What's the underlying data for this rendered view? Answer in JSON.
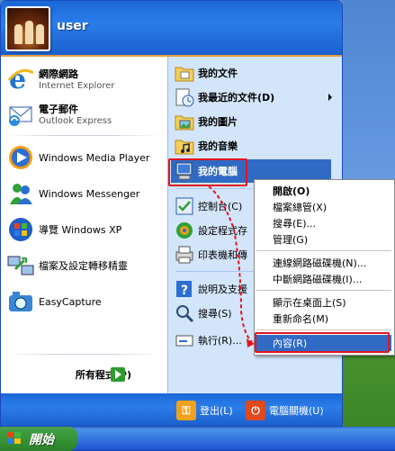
{
  "user": {
    "name": "user"
  },
  "left_items": [
    {
      "title": "網際網路",
      "subtitle": "Internet Explorer",
      "icon": "internet-explorer-icon"
    },
    {
      "title": "電子郵件",
      "subtitle": "Outlook Express",
      "icon": "outlook-express-icon"
    },
    {
      "label": "Windows Media Player",
      "icon": "media-player-icon"
    },
    {
      "label": "Windows Messenger",
      "icon": "messenger-icon"
    },
    {
      "label": "導覽 Windows XP",
      "icon": "tour-xp-icon"
    },
    {
      "label": "檔案及設定轉移精靈",
      "icon": "transfer-wizard-icon"
    },
    {
      "label": "EasyCapture",
      "icon": "easycapture-icon"
    }
  ],
  "all_programs": {
    "label": "所有程式(P)"
  },
  "right_items": [
    {
      "label": "我的文件",
      "bold": true,
      "icon": "my-documents-icon"
    },
    {
      "label": "我最近的文件(D)",
      "bold": true,
      "icon": "recent-documents-icon",
      "submenu": true
    },
    {
      "label": "我的圖片",
      "bold": true,
      "icon": "my-pictures-icon"
    },
    {
      "label": "我的音樂",
      "bold": true,
      "icon": "my-music-icon"
    },
    {
      "label": "我的電腦",
      "bold": true,
      "icon": "my-computer-icon",
      "highlighted": true
    },
    {
      "label": "控制台(C)",
      "icon": "control-panel-icon"
    },
    {
      "label": "設定程式存",
      "icon": "set-program-access-icon"
    },
    {
      "label": "印表機和傳",
      "icon": "printers-faxes-icon"
    },
    {
      "label": "說明及支援",
      "icon": "help-support-icon"
    },
    {
      "label": "搜尋(S)",
      "icon": "search-icon"
    },
    {
      "label": "執行(R)...",
      "icon": "run-icon"
    }
  ],
  "footer": {
    "logoff": "登出(L)",
    "shutdown": "電腦關機(U)"
  },
  "taskbar": {
    "start": "開始"
  },
  "context_menu": [
    {
      "label": "開啟(O)",
      "bold": true
    },
    {
      "label": "檔案總管(X)"
    },
    {
      "label": "搜尋(E)..."
    },
    {
      "label": "管理(G)"
    },
    {
      "separator": true
    },
    {
      "label": "連線網路磁碟機(N)..."
    },
    {
      "label": "中斷網路磁碟機(I)..."
    },
    {
      "separator": true
    },
    {
      "label": "顯示在桌面上(S)"
    },
    {
      "label": "重新命名(M)"
    },
    {
      "separator": true
    },
    {
      "label": "內容(R)",
      "selected": true
    }
  ],
  "colors": {
    "accent_blue": "#1a67d6",
    "highlight": "#316ac5",
    "annotation_red": "#e2151b",
    "start_green": "#3c9a3c"
  }
}
